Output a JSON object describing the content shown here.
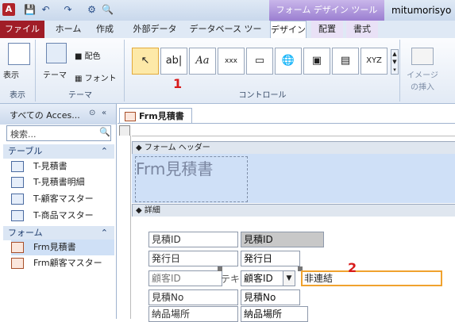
{
  "app": {
    "icon_letter": "A",
    "context_header": "フォーム デザイン ツール",
    "user": "mitumorisyo"
  },
  "tabs": [
    "ファイル",
    "ホーム",
    "作成",
    "外部データ",
    "データベース ツール",
    "デザイン",
    "配置",
    "書式"
  ],
  "ribbon": {
    "views": {
      "label": "表示",
      "button": "表示"
    },
    "themes": {
      "label": "テーマ",
      "theme": "テーマ",
      "colors": "配色",
      "fonts": "フォント"
    },
    "controls": {
      "label": "コントロール"
    },
    "insert_image": "イメージの挿入"
  },
  "nav": {
    "title": "すべての Acces...",
    "search_placeholder": "検索...",
    "sections": [
      {
        "name": "テーブル",
        "items": [
          "T-見積書",
          "T-見積書明細",
          "T-顧客マスター",
          "T-商品マスター"
        ]
      },
      {
        "name": "フォーム",
        "items": [
          "Frm見積書",
          "Frm顧客マスター"
        ]
      }
    ]
  },
  "document": {
    "tab": "Frm見積書",
    "form_header": "フォーム ヘッダー",
    "form_title": "Frm見積書",
    "detail": "詳細",
    "rows": [
      {
        "label": "見積ID",
        "field": "見積ID"
      },
      {
        "label": "発行日",
        "field": "発行日"
      },
      {
        "label": "顧客ID",
        "field": "顧客ID"
      },
      {
        "label": "見積No",
        "field": "見積No"
      },
      {
        "label": "納品場所",
        "field": "納品場所"
      }
    ],
    "text_label": "テキ",
    "unbound": "非連結"
  },
  "callouts": {
    "one": "1",
    "two": "2"
  }
}
